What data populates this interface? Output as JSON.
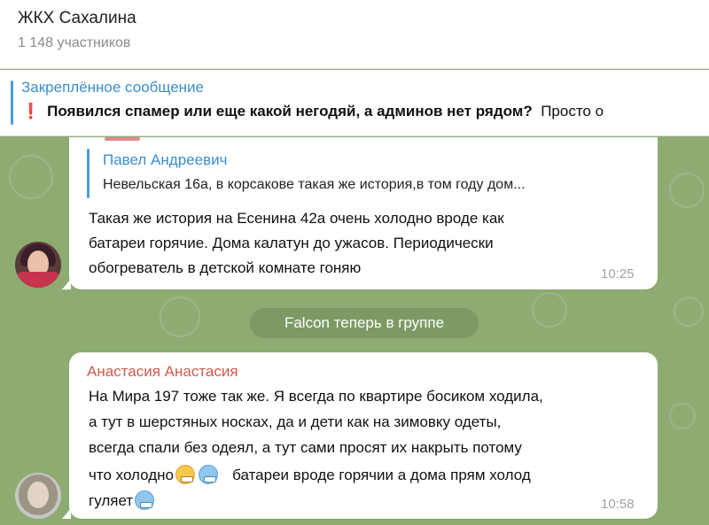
{
  "header": {
    "title": "ЖКХ Сахалина",
    "subtitle": "1 148 участников"
  },
  "pinned": {
    "label": "Закреплённое сообщение",
    "icon": "exclamation-icon",
    "icon_color": "#e3262b",
    "icon_glyph": "❗",
    "text_bold": "Появился спамер или еще какой негодяй, а админов нет рядом?",
    "text_rest": "Просто о"
  },
  "messages": [
    {
      "reply": {
        "author": "Павел Андреевич",
        "text": "Невельская 16а, в корсакове такая же история,в том году дом..."
      },
      "lines": [
        "Такая же история  на Есенина 42а  очень холодно вроде как",
        "батареи горячие.  Дома калатун до ужасов. Периодически",
        "обогреватель в детской комнате гоняю"
      ],
      "time": "10:25"
    },
    {
      "author": "Анастасия Анастасия",
      "author_color": "#d05a4a",
      "lines": [
        "На Мира 197 тоже так же. Я всегда по квартире босиком ходила,",
        "а тут в шерстяных носках, да и дети как на зимовку одеты,",
        "всегда спали без одеял, а тут сами просят их накрыть потому",
        "что холодно",
        "батареи вроде горячии а дома прям холод",
        "гуляет"
      ],
      "emojis": [
        "grimacing-face",
        "cold-face",
        "cold-face"
      ],
      "time": "10:58"
    }
  ],
  "service_message": "Falcon теперь в группе",
  "colors": {
    "accent_blue": "#3a8ed0",
    "wallpaper": "#8eac72",
    "bubble": "#ffffff"
  }
}
